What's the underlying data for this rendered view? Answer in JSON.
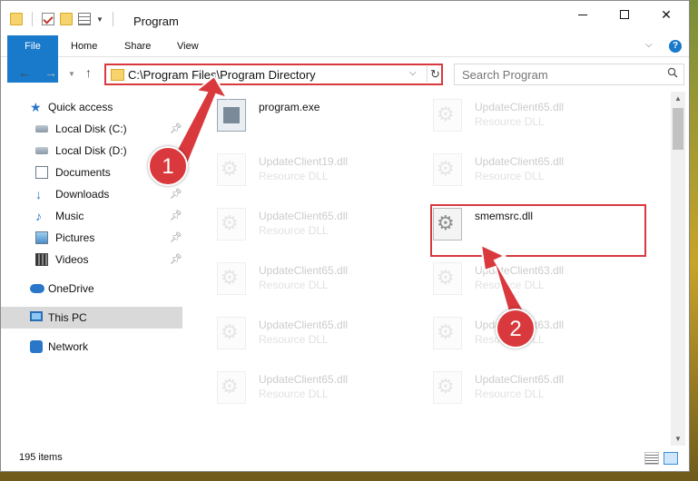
{
  "window": {
    "title": "Program"
  },
  "ribbon": {
    "tabs": [
      "File",
      "Home",
      "Share",
      "View"
    ],
    "help": "?"
  },
  "nav": {
    "address": "C:\\Program Files\\Program Directory",
    "search_placeholder": "Search Program"
  },
  "sidebar": {
    "items": [
      {
        "label": "Quick access",
        "icon": "star-icon"
      },
      {
        "label": "Local Disk (C:)",
        "icon": "disk-icon",
        "pinned": true
      },
      {
        "label": "Local Disk (D:)",
        "icon": "disk-icon"
      },
      {
        "label": "Documents",
        "icon": "documents-icon",
        "pinned": true
      },
      {
        "label": "Downloads",
        "icon": "download-icon",
        "pinned": true
      },
      {
        "label": "Music",
        "icon": "music-icon",
        "pinned": true
      },
      {
        "label": "Pictures",
        "icon": "pictures-icon",
        "pinned": true
      },
      {
        "label": "Videos",
        "icon": "videos-icon",
        "pinned": true
      },
      {
        "label": "OneDrive",
        "icon": "onedrive-icon"
      },
      {
        "label": "This PC",
        "icon": "pc-icon",
        "selected": true
      },
      {
        "label": "Network",
        "icon": "network-icon"
      }
    ]
  },
  "files": {
    "left": [
      {
        "name": "program.exe",
        "type": ""
      },
      {
        "name": "UpdateClient19.dll",
        "type": "Resource DLL"
      },
      {
        "name": "UpdateClient65.dll",
        "type": "Resource DLL"
      },
      {
        "name": "UpdateClient65.dll",
        "type": "Resource DLL"
      },
      {
        "name": "UpdateClient65.dll",
        "type": "Resource DLL"
      },
      {
        "name": "UpdateClient65.dll",
        "type": "Resource DLL"
      }
    ],
    "right": [
      {
        "name": "UpdateClient65.dll",
        "type": "Resource DLL"
      },
      {
        "name": "UpdateClient65.dll",
        "type": "Resource DLL"
      },
      {
        "name": "smemsrc.dll",
        "type": ""
      },
      {
        "name": "UpdateClient63.dll",
        "type": "Resource DLL"
      },
      {
        "name": "UpdateClient63.dll",
        "type": "Resource DLL"
      },
      {
        "name": "UpdateClient65.dll",
        "type": "Resource DLL"
      }
    ]
  },
  "status": {
    "count": "195 items"
  },
  "annotations": {
    "step1": "1",
    "step2": "2"
  },
  "colors": {
    "accent": "#1979ca",
    "highlight": "#d9393d"
  }
}
